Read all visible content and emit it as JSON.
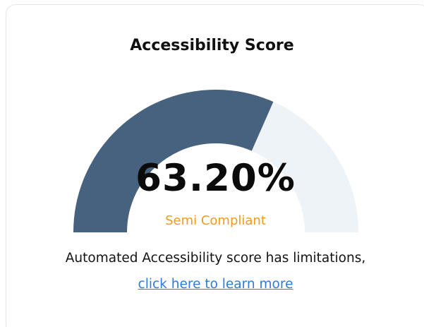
{
  "card": {
    "title": "Accessibility Score",
    "score_text": "63.20%",
    "score_value": 63.2,
    "status": "Semi Compliant",
    "note": "Automated Accessibility score has limitations,",
    "link_text": "click here to learn more"
  },
  "colors": {
    "gauge_fill": "#47627e",
    "gauge_track": "#eef3f8",
    "status": "#f29a1f",
    "link": "#2d7be0"
  }
}
